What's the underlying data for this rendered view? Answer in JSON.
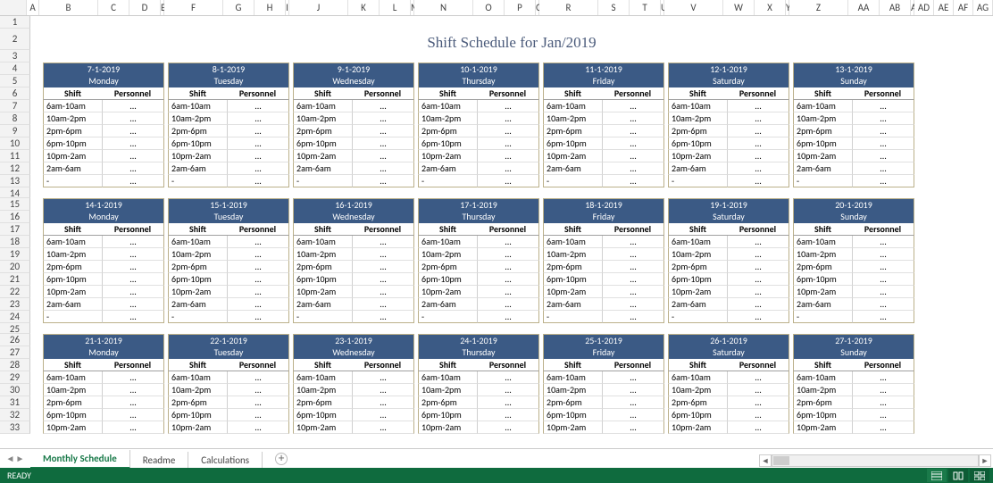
{
  "title": "Shift Schedule for Jan/2019",
  "columns": [
    "A",
    "B",
    "C",
    "D",
    "E",
    "F",
    "G",
    "H",
    "I",
    "J",
    "K",
    "L",
    "M",
    "N",
    "O",
    "P",
    "Q",
    "R",
    "S",
    "T",
    "U",
    "V",
    "W",
    "X",
    "Y",
    "Z",
    "AA",
    "AB",
    "AC",
    "AD",
    "AE",
    "AF",
    "AG"
  ],
  "row_labels_start": 1,
  "row_labels_end": 33,
  "col_headers": {
    "shift": "Shift",
    "personnel": "Personnel"
  },
  "shifts": [
    "6am-10am",
    "10am-2pm",
    "2pm-6pm",
    "6pm-10pm",
    "10pm-2am",
    "2am-6am",
    "-"
  ],
  "shifts_short": [
    "6am-10am",
    "10am-2pm",
    "2pm-6pm",
    "6pm-10pm",
    "10pm-2am"
  ],
  "personnel_placeholder": "...",
  "weeks": [
    {
      "days": [
        {
          "date": "7-1-2019",
          "dow": "Monday"
        },
        {
          "date": "8-1-2019",
          "dow": "Tuesday"
        },
        {
          "date": "9-1-2019",
          "dow": "Wednesday"
        },
        {
          "date": "10-1-2019",
          "dow": "Thursday"
        },
        {
          "date": "11-1-2019",
          "dow": "Friday"
        },
        {
          "date": "12-1-2019",
          "dow": "Saturday"
        },
        {
          "date": "13-1-2019",
          "dow": "Sunday"
        }
      ]
    },
    {
      "days": [
        {
          "date": "14-1-2019",
          "dow": "Monday"
        },
        {
          "date": "15-1-2019",
          "dow": "Tuesday"
        },
        {
          "date": "16-1-2019",
          "dow": "Wednesday"
        },
        {
          "date": "17-1-2019",
          "dow": "Thursday"
        },
        {
          "date": "18-1-2019",
          "dow": "Friday"
        },
        {
          "date": "19-1-2019",
          "dow": "Saturday"
        },
        {
          "date": "20-1-2019",
          "dow": "Sunday"
        }
      ]
    },
    {
      "days": [
        {
          "date": "21-1-2019",
          "dow": "Monday"
        },
        {
          "date": "22-1-2019",
          "dow": "Tuesday"
        },
        {
          "date": "23-1-2019",
          "dow": "Wednesday"
        },
        {
          "date": "24-1-2019",
          "dow": "Thursday"
        },
        {
          "date": "25-1-2019",
          "dow": "Friday"
        },
        {
          "date": "26-1-2019",
          "dow": "Saturday"
        },
        {
          "date": "27-1-2019",
          "dow": "Sunday"
        }
      ]
    }
  ],
  "tabs": [
    {
      "label": "Monthly Schedule",
      "active": true
    },
    {
      "label": "Readme",
      "active": false
    },
    {
      "label": "Calculations",
      "active": false
    }
  ],
  "status": "READY"
}
